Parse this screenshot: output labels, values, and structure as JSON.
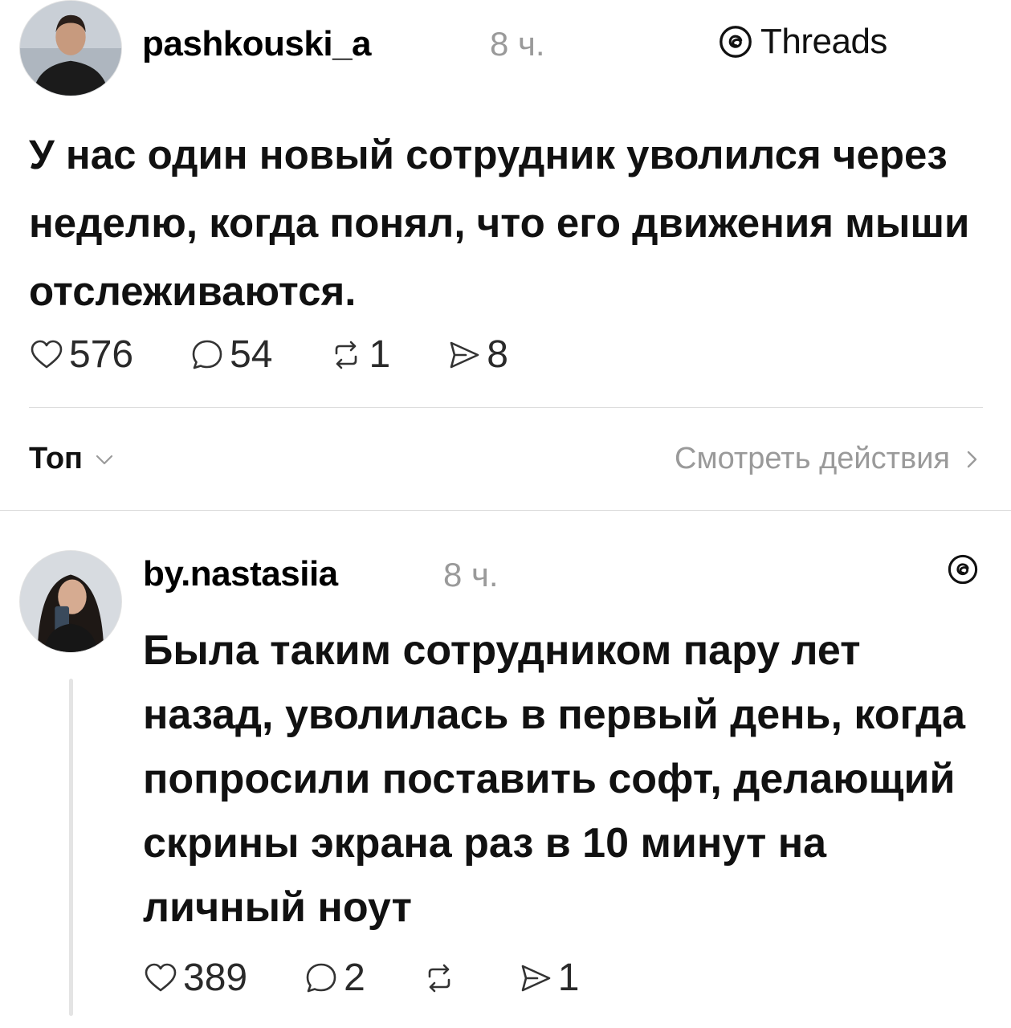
{
  "post": {
    "username": "pashkouski_a",
    "time": "8 ч.",
    "text": "У нас один новый сотрудник уволился через неделю, когда понял, что его движения мыши отслеживаются.",
    "likes": "576",
    "comments": "54",
    "reposts": "1",
    "shares": "8"
  },
  "brand": {
    "label": "Threads",
    "icon": "threads-logo-icon"
  },
  "sort": {
    "label": "Топ",
    "icon": "chevron-down-icon"
  },
  "activity": {
    "label": "Смотреть действия",
    "icon": "chevron-right-icon"
  },
  "reply": {
    "username": "by.nastasiia",
    "time": "8 ч.",
    "text": "Была таким сотрудником пару лет назад, уволилась в первый день, когда попросили поставить софт, делающий скрины экрана раз в 10 минут на личный ноут",
    "likes": "389",
    "comments": "2",
    "reposts": "",
    "shares": "1"
  }
}
